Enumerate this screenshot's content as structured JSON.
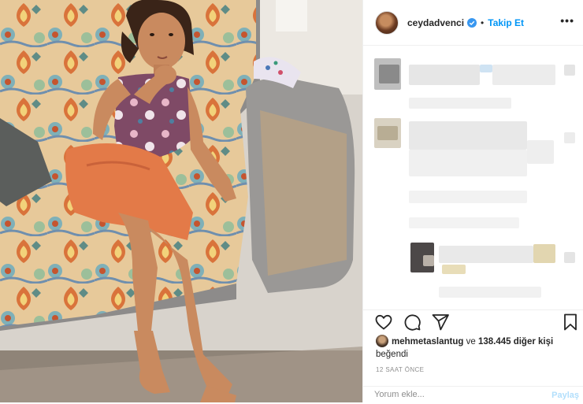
{
  "header": {
    "username": "ceydadvenci",
    "separator": "•",
    "follow_label": "Takip Et",
    "more_label": "•••"
  },
  "likes": {
    "user": "mehmetaslantug",
    "joiner": " ve ",
    "count_text": "138.445 diğer kişi",
    "suffix": " beğendi"
  },
  "timestamp": "12 SAAT ÖNCE",
  "comment_input": {
    "placeholder": "Yorum ekle...",
    "post_label": "Paylaş"
  },
  "icons": {
    "verified": "verified-badge-icon",
    "like": "heart-icon",
    "comment": "comment-icon",
    "share": "share-icon",
    "save": "bookmark-icon"
  },
  "colors": {
    "accent": "#0095f6",
    "text": "#262626",
    "muted": "#8e8e8e",
    "border": "#efefef"
  }
}
